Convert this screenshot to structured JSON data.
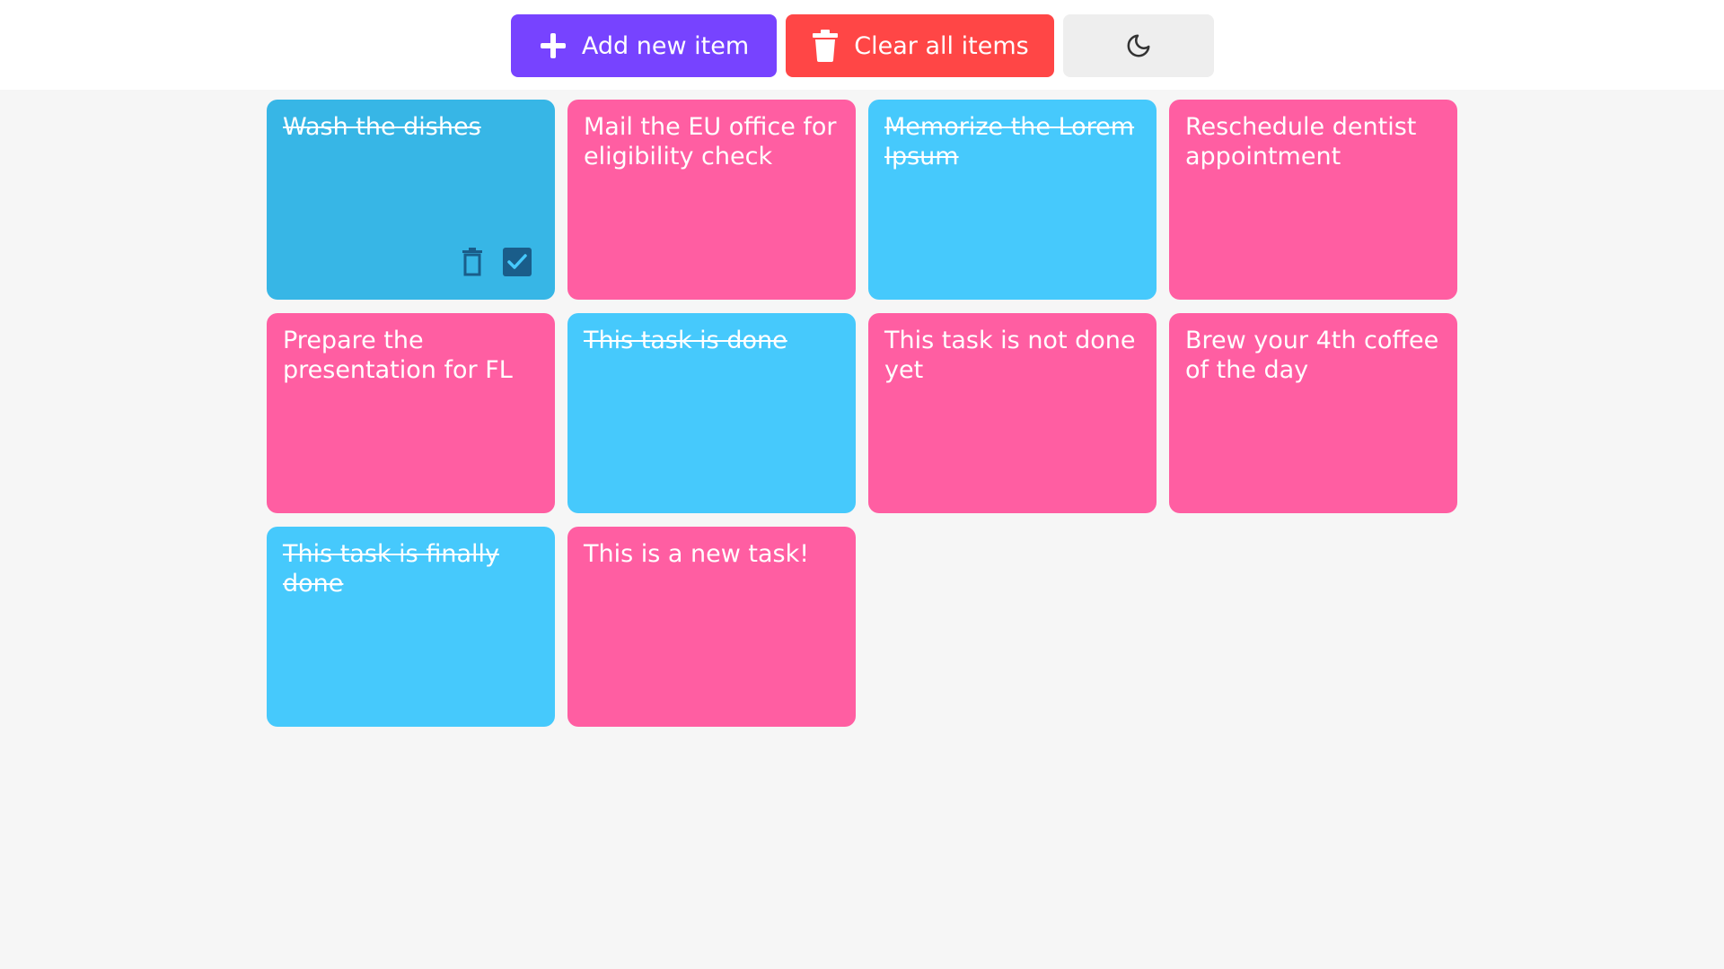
{
  "colors": {
    "add_button": "#7743ff",
    "clear_button": "#ff4646",
    "theme_button": "#eeeeee",
    "card_pink": "#ff5ea2",
    "card_blue": "#46c9fc",
    "card_blue_hover": "#37b6e6",
    "card_icon": "#1a5d8a",
    "page_background": "#f6f6f6"
  },
  "toolbar": {
    "add_label": "Add new item",
    "add_icon": "plus-icon",
    "clear_label": "Clear all items",
    "clear_icon": "trash-icon",
    "theme_icon": "moon-icon"
  },
  "tasks": [
    {
      "text": "Wash the dishes",
      "done": true,
      "color": "blue",
      "hovered": true
    },
    {
      "text": "Mail the EU office for eligibility check",
      "done": false,
      "color": "pink"
    },
    {
      "text": "Memorize the Lorem Ipsum",
      "done": true,
      "color": "blue"
    },
    {
      "text": "Reschedule dentist appointment",
      "done": false,
      "color": "pink"
    },
    {
      "text": "Prepare the presentation for FL",
      "done": false,
      "color": "pink"
    },
    {
      "text": "This task is done",
      "done": true,
      "color": "blue"
    },
    {
      "text": "This task is not done yet",
      "done": false,
      "color": "pink"
    },
    {
      "text": "Brew your 4th coffee of the day",
      "done": false,
      "color": "pink"
    },
    {
      "text": "This task is finally done",
      "done": true,
      "color": "blue"
    },
    {
      "text": "This is a new task!",
      "done": false,
      "color": "pink"
    }
  ],
  "task_actions": {
    "delete_icon": "trash-icon",
    "toggle_icon": "checkbox-checked-icon"
  }
}
